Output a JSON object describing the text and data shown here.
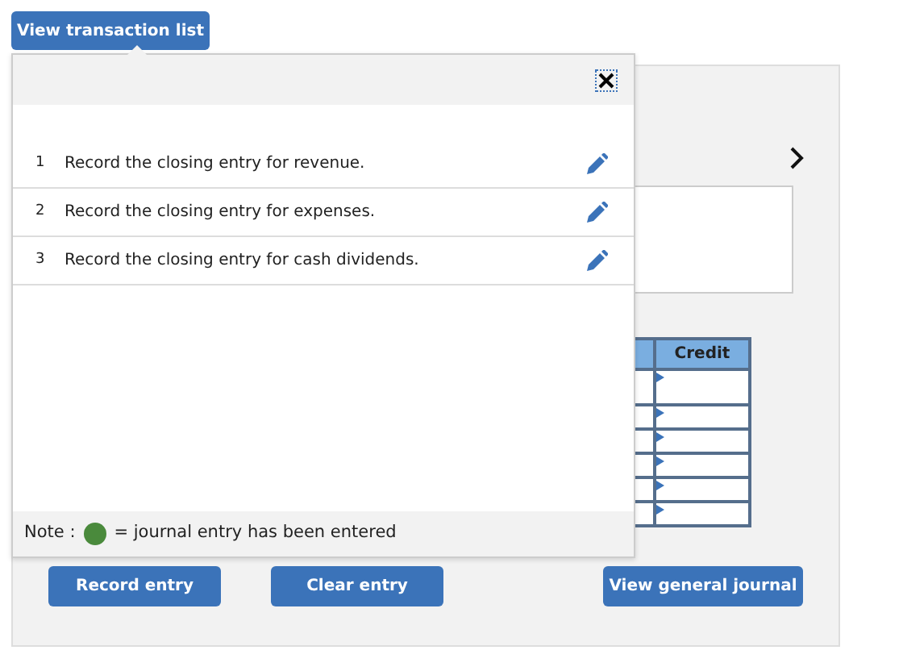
{
  "top_button": "View transaction list",
  "transactions": [
    {
      "number": "1",
      "text": "Record the closing entry for revenue."
    },
    {
      "number": "2",
      "text": "Record the closing entry for expenses."
    },
    {
      "number": "3",
      "text": "Record the closing entry for cash dividends."
    }
  ],
  "note": {
    "label": "Note :",
    "text": "= journal entry has been entered"
  },
  "journal": {
    "columns": [
      "Credit"
    ],
    "rows": [
      {
        "kind": "tall"
      },
      {
        "kind": "short"
      },
      {
        "kind": "short"
      },
      {
        "kind": "short"
      },
      {
        "kind": "short"
      },
      {
        "kind": "short"
      }
    ]
  },
  "buttons": [
    "Record entry",
    "Clear entry",
    "View general journal"
  ]
}
